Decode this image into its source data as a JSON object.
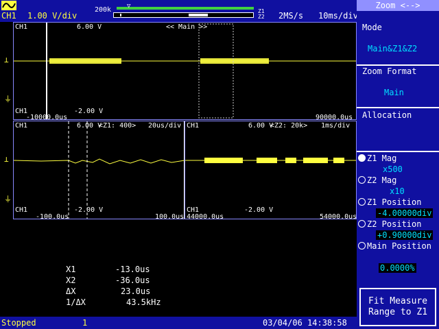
{
  "header": {
    "channel": "CH1",
    "vdiv": "1.00 V/div",
    "record": "200k",
    "z1": "Z1",
    "z2": "Z2",
    "samplerate": "2MS/s",
    "timebase": "10ms/div"
  },
  "main_window": {
    "ch": "CH1",
    "top_v": "6.00 V",
    "title": "<< Main >>",
    "bottom_v": "-2.00 V",
    "left_t": "-10000.0us",
    "right_t": "90000.0us"
  },
  "zoom1": {
    "ch": "CH1",
    "top_v": "6.00 V",
    "info": "<Z1: 400>",
    "tdiv": "20us/div",
    "bottom_v": "-2.00 V",
    "left_t": "-100.0us",
    "right_t": "100.0us"
  },
  "zoom2": {
    "ch": "CH1",
    "top_v": "6.00 V",
    "info": "<Z2: 20k>",
    "tdiv": "1ms/div",
    "bottom_v": "-2.00 V",
    "left_t": "44000.0us",
    "right_t": "54000.0us"
  },
  "measurements": [
    {
      "label": "X1",
      "value": "-13.0us"
    },
    {
      "label": "X2",
      "value": "-36.0us"
    },
    {
      "label": "ΔX",
      "value": "23.0us"
    },
    {
      "label": "1/ΔX",
      "value": "43.5kHz"
    }
  ],
  "status": {
    "state": "Stopped",
    "count": "1",
    "datetime": "03/04/06 14:38:58"
  },
  "sidebar": {
    "title": "Zoom <-->",
    "mode_label": "Mode",
    "mode_value": "Main&Z1&Z2",
    "format_label": "Zoom Format",
    "format_value": "Main",
    "allocation_label": "Allocation",
    "z1mag_label": "Z1 Mag",
    "z1mag_value": "x500",
    "z2mag_label": "Z2 Mag",
    "z2mag_value": "x10",
    "z1pos_label": "Z1 Position",
    "z1pos_value": "-4.00000div",
    "z2pos_label": "Z2 Position",
    "z2pos_value": "+0.90000div",
    "mainpos_label": "Main Position",
    "mainpos_value": "0.0000%",
    "fit_line1": "Fit Measure",
    "fit_line2": "Range to Z1"
  },
  "colors": {
    "trace": "#ffff40",
    "panel": "#1010a0",
    "accent": "#00e0ff"
  }
}
